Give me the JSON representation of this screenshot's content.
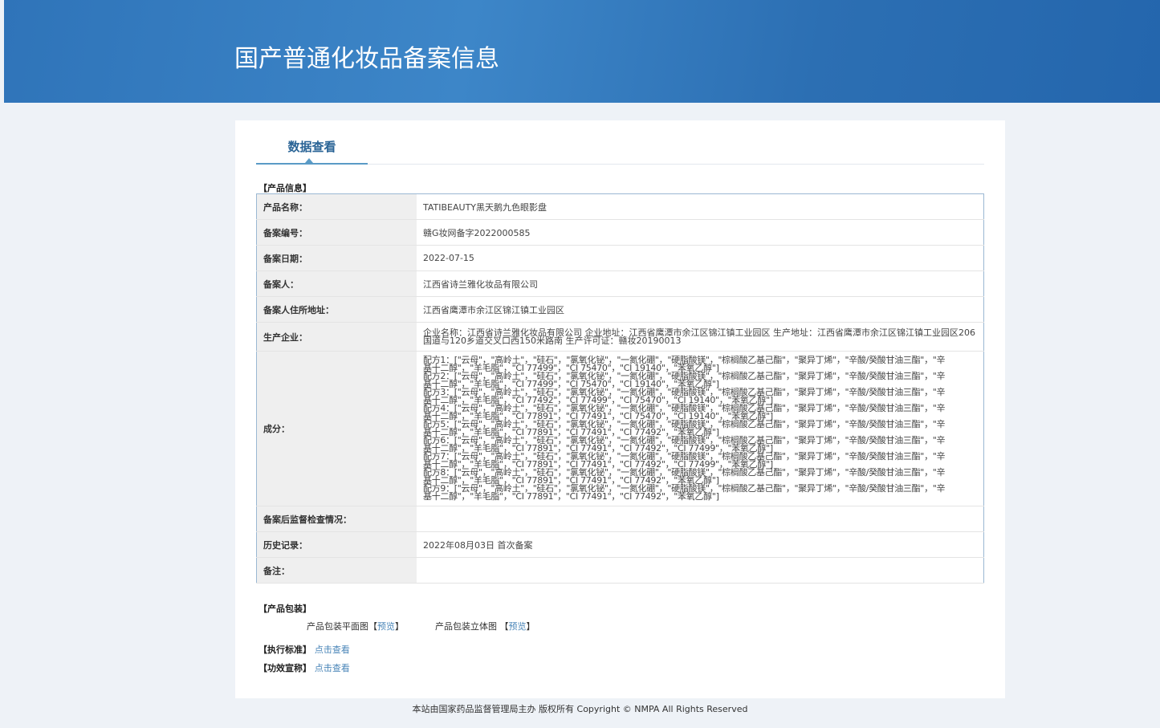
{
  "header": {
    "title": "国产普通化妆品备案信息"
  },
  "tab": {
    "label": "数据查看"
  },
  "sections": {
    "product_info": "【产品信息】",
    "packaging": "【产品包装】",
    "standard": "【执行标准】",
    "efficacy": "【功效宣称】"
  },
  "rows": [
    {
      "label": "产品名称：",
      "value": "TATIBEAUTY黑天鹅九色眼影盘"
    },
    {
      "label": "备案编号：",
      "value": "赣G妆网备字2022000585"
    },
    {
      "label": "备案日期：",
      "value": "2022-07-15"
    },
    {
      "label": "备案人：",
      "value": "江西省诗兰雅化妆品有限公司"
    },
    {
      "label": "备案人住所地址：",
      "value": "江西省鹰潭市余江区锦江镇工业园区"
    },
    {
      "label": "生产企业：",
      "value": "企业名称：江西省诗兰雅化妆品有限公司 企业地址：江西省鹰潭市余江区锦江镇工业园区 生产地址：江西省鹰潭市余江区锦江镇工业园区206国道与120乡道交叉口西150米路南 生产许可证：赣妆20190013"
    },
    {
      "label": "成分：",
      "value": ""
    },
    {
      "label": "备案后监督检查情况：",
      "value": ""
    },
    {
      "label": "历史记录：",
      "value": "2022年08月03日 首次备案"
    },
    {
      "label": "备注：",
      "value": ""
    }
  ],
  "ingredients": [
    "配方1：[\"云母\"，\"高岭土\"，\"硅石\"，\"氯氧化铋\"，\"一氮化硼\"，\"硬脂酸镁\"，\"棕榈酸乙基己酯\"，\"聚异丁烯\"，\"辛酸/癸酸甘油三酯\"，\"辛基十二醇\"，\"羊毛脂\"，\"CI 77499\"，\"CI 75470\"，\"CI 19140\"，\"苯氧乙醇\"]",
    "配方2：[\"云母\"，\"高岭土\"，\"硅石\"，\"氯氧化铋\"，\"一氮化硼\"，\"硬脂酸镁\"，\"棕榈酸乙基己酯\"，\"聚异丁烯\"，\"辛酸/癸酸甘油三酯\"，\"辛基十二醇\"，\"羊毛脂\"，\"CI 77499\"，\"CI 75470\"，\"CI 19140\"，\"苯氧乙醇\"]",
    "配方3：[\"云母\"，\"高岭土\"，\"硅石\"，\"氯氧化铋\"，\"一氮化硼\"，\"硬脂酸镁\"，\"棕榈酸乙基己酯\"，\"聚异丁烯\"，\"辛酸/癸酸甘油三酯\"，\"辛基十二醇\"，\"羊毛脂\"，\"CI 77492\"，\"CI 77499\"，\"CI 75470\"，\"CI 19140\"，\"苯氧乙醇\"]",
    "配方4：[\"云母\"，\"高岭土\"，\"硅石\"，\"氯氧化铋\"，\"一氮化硼\"，\"硬脂酸镁\"，\"棕榈酸乙基己酯\"，\"聚异丁烯\"，\"辛酸/癸酸甘油三酯\"，\"辛基十二醇\"，\"羊毛脂\"，\"CI 77891\"，\"CI 77491\"，\"CI 75470\"，\"CI 19140\"，\"苯氧乙醇\"]",
    "配方5：[\"云母\"，\"高岭土\"，\"硅石\"，\"氯氧化铋\"，\"一氮化硼\"，\"硬脂酸镁\"，\"棕榈酸乙基己酯\"，\"聚异丁烯\"，\"辛酸/癸酸甘油三酯\"，\"辛基十二醇\"，\"羊毛脂\"，\"CI 77891\"，\"CI 77491\"，\"CI 77492\"，\"苯氧乙醇\"]",
    "配方6：[\"云母\"，\"高岭土\"，\"硅石\"，\"氯氧化铋\"，\"一氮化硼\"，\"硬脂酸镁\"，\"棕榈酸乙基己酯\"，\"聚异丁烯\"，\"辛酸/癸酸甘油三酯\"，\"辛基十二醇\"，\"羊毛脂\"，\"CI 77891\"，\"CI 77491\"，\"CI 77492\"，\"CI 77499\"，\"苯氧乙醇\"]",
    "配方7：[\"云母\"，\"高岭土\"，\"硅石\"，\"氯氧化铋\"，\"一氮化硼\"，\"硬脂酸镁\"，\"棕榈酸乙基己酯\"，\"聚异丁烯\"，\"辛酸/癸酸甘油三酯\"，\"辛基十二醇\"，\"羊毛脂\"，\"CI 77891\"，\"CI 77491\"，\"CI 77492\"，\"CI 77499\"，\"苯氧乙醇\"]",
    "配方8：[\"云母\"，\"高岭土\"，\"硅石\"，\"氯氧化铋\"，\"一氮化硼\"，\"硬脂酸镁\"，\"棕榈酸乙基己酯\"，\"聚异丁烯\"，\"辛酸/癸酸甘油三酯\"，\"辛基十二醇\"，\"羊毛脂\"，\"CI 77891\"，\"CI 77491\"，\"CI 77492\"，\"苯氧乙醇\"]",
    "配方9：[\"云母\"，\"高岭土\"，\"硅石\"，\"氯氧化铋\"，\"一氮化硼\"，\"硬脂酸镁\"，\"棕榈酸乙基己酯\"，\"聚异丁烯\"，\"辛酸/癸酸甘油三酯\"，\"辛基十二醇\"，\"羊毛脂\"，\"CI 77891\"，\"CI 77491\"，\"CI 77492\"，\"苯氧乙醇\"]"
  ],
  "packaging": {
    "flat_label": "产品包装平面图",
    "solid_label": "产品包装立体图",
    "bracket_open": "【",
    "bracket_close": "】",
    "preview": "预览"
  },
  "links": {
    "view": "点击查看"
  },
  "footer": {
    "text": "本站由国家药品监督管理局主办 版权所有 Copyright © NMPA All Rights Reserved"
  },
  "colors": {
    "header": "#2f74b9",
    "link": "#4a86b8",
    "background": "#eef2f7"
  }
}
